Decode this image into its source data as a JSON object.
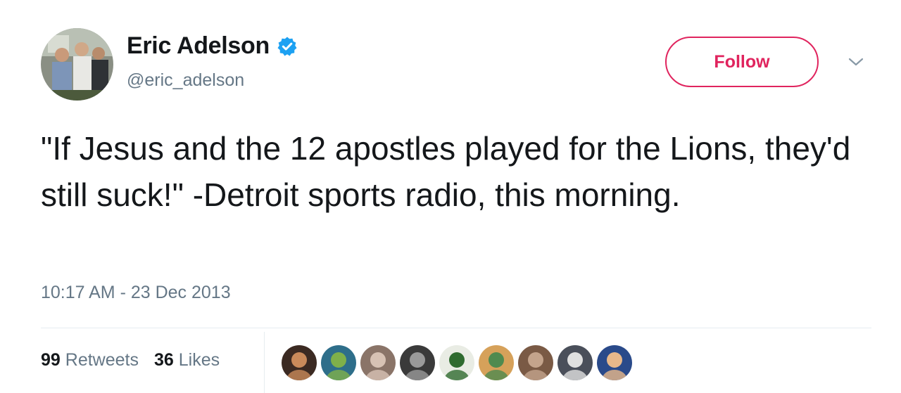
{
  "user": {
    "display_name": "Eric Adelson",
    "handle": "@eric_adelson",
    "verified": true,
    "avatar_icon": "profile-photo-icon"
  },
  "actions": {
    "follow_label": "Follow",
    "menu_icon": "chevron-down-icon"
  },
  "tweet": {
    "text": "\"If Jesus and the 12 apostles played for the Lions, they'd still suck!\" -Detroit sports radio, this morning.",
    "timestamp": "10:17 AM - 23 Dec 2013"
  },
  "stats": {
    "retweets_count": "99",
    "retweets_label": "Retweets",
    "likes_count": "36",
    "likes_label": "Likes"
  },
  "likers": [
    {
      "icon": "liker-avatar-1",
      "bg": "#3b2a22",
      "fg": "#c98a5a"
    },
    {
      "icon": "liker-avatar-2",
      "bg": "#2e6e8a",
      "fg": "#7fb04a"
    },
    {
      "icon": "liker-avatar-3",
      "bg": "#8a7468",
      "fg": "#d7c2b4"
    },
    {
      "icon": "liker-avatar-4",
      "bg": "#3a3a3a",
      "fg": "#9a9a9a"
    },
    {
      "icon": "liker-avatar-5",
      "bg": "#e9ece4",
      "fg": "#2f6b2f"
    },
    {
      "icon": "liker-avatar-6",
      "bg": "#d6a15a",
      "fg": "#4f8a4f"
    },
    {
      "icon": "liker-avatar-7",
      "bg": "#7a5a45",
      "fg": "#c4a48c"
    },
    {
      "icon": "liker-avatar-8",
      "bg": "#4a4f5a",
      "fg": "#e0e0e0"
    },
    {
      "icon": "liker-avatar-9",
      "bg": "#2a4a8a",
      "fg": "#e8b88a"
    }
  ],
  "colors": {
    "follow_accent": "#e0245e",
    "verified_blue": "#1da1f2",
    "secondary_text": "#657786",
    "primary_text": "#14171a"
  }
}
